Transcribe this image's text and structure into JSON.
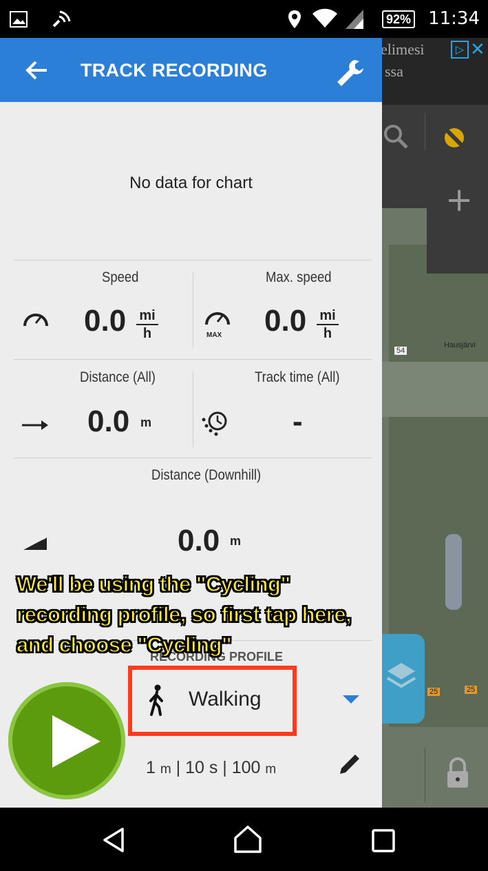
{
  "status_bar": {
    "battery": "92%",
    "time": "11:34"
  },
  "app_bar": {
    "title": "TRACK RECORDING",
    "back_icon": "arrow-left-icon",
    "settings_icon": "wrench-icon"
  },
  "chart": {
    "empty_text": "No data for chart"
  },
  "stats": {
    "speed": {
      "label": "Speed",
      "value": "0.0",
      "unit_top": "mi",
      "unit_bottom": "h"
    },
    "max_speed": {
      "label": "Max. speed",
      "value": "0.0",
      "unit_top": "mi",
      "unit_bottom": "h",
      "badge": "MAX"
    },
    "distance_all": {
      "label": "Distance (All)",
      "value": "0.0",
      "unit": "m"
    },
    "track_time_all": {
      "label": "Track time (All)",
      "value": "-"
    },
    "distance_downhill": {
      "label": "Distance (Downhill)",
      "value": "0.0",
      "unit": "m"
    }
  },
  "recording_profile": {
    "label": "RECORDING PROFILE",
    "selected": "Walking",
    "settings_parts": {
      "dist": "1",
      "dist_unit": "m",
      "sep1": " | ",
      "time": "10 s",
      "sep2": " | ",
      "dist2": "100",
      "dist2_unit": "m"
    }
  },
  "annotation": {
    "line1": "We'll be using the \"Cycling\"",
    "line2": "recording profile, so first tap here,",
    "line3": "and choose \"Cycling\"",
    "color": "#ffeb3b"
  },
  "map": {
    "ad_text_1": "elimesi",
    "ad_text_2": "ssa",
    "place_label": "Hausjärvi",
    "road_label_1": "54",
    "road_label_2": "25",
    "road_label_3": "25"
  },
  "colors": {
    "app_bar": "#2b7fd6",
    "play_button": "#5c9a0e",
    "highlight": "#ff3b1f"
  }
}
